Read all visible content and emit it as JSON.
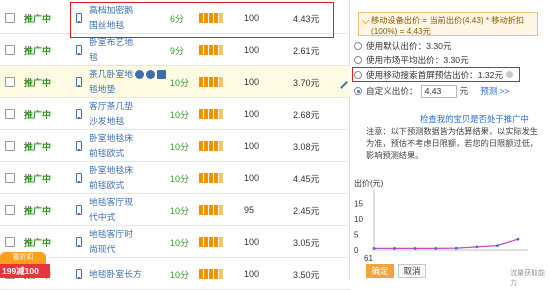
{
  "rows": [
    {
      "status": "推广中",
      "title1": "高档加密鹅",
      "title2": "国丝地毯",
      "score": "6分",
      "bars": 5,
      "pv": "100",
      "price": "4.43元",
      "highlight": false,
      "icons": false
    },
    {
      "status": "推广中",
      "title1": "卧室布艺地",
      "title2": "毯",
      "score": "9分",
      "bars": 5,
      "pv": "100",
      "price": "2.61元",
      "highlight": false,
      "icons": false
    },
    {
      "status": "推广中",
      "title1": "茶几卧室地",
      "title2": "毯地垫",
      "score": "10分",
      "bars": 5,
      "pv": "100",
      "price": "3.70元",
      "highlight": true,
      "icons": true
    },
    {
      "status": "推广中",
      "title1": "客厅茶几垫",
      "title2": "沙发地毯",
      "score": "10分",
      "bars": 5,
      "pv": "100",
      "price": "2.68元",
      "highlight": false,
      "icons": false
    },
    {
      "status": "推广中",
      "title1": "卧室地毯床",
      "title2": "前毯欧式",
      "score": "10分",
      "bars": 5,
      "pv": "100",
      "price": "3.08元",
      "highlight": false,
      "icons": false
    },
    {
      "status": "推广中",
      "title1": "卧室地毯床",
      "title2": "前毯欧式",
      "score": "10分",
      "bars": 5,
      "pv": "100",
      "price": "4.45元",
      "highlight": false,
      "icons": false
    },
    {
      "status": "推广中",
      "title1": "地毯客厅现",
      "title2": "代中式",
      "score": "10分",
      "bars": 5,
      "pv": "95",
      "price": "2.45元",
      "highlight": false,
      "icons": false
    },
    {
      "status": "推广中",
      "title1": "地毯客厅时",
      "title2": "尚现代",
      "score": "10分",
      "bars": 5,
      "pv": "100",
      "price": "3.05元",
      "highlight": false,
      "icons": false
    },
    {
      "status": "推广中",
      "title1": "地毯卧室长方",
      "title2": "",
      "score": "10分",
      "bars": 5,
      "pv": "100",
      "price": "3.50元",
      "highlight": false,
      "icons": false
    }
  ],
  "promo": {
    "top": "惠折扣",
    "bottom": "199减100"
  },
  "panel": {
    "notice": "移动设备出价 = 当前出价(4.43) * 移动折扣(100%) = 4.43元",
    "options": [
      {
        "label": "使用默认出价：3.30元",
        "selected": false
      },
      {
        "label": "使用市场平均出价：3.30元",
        "selected": false
      },
      {
        "label": "使用移动搜索首屏预估出价：1.32元",
        "selected": false
      }
    ],
    "custom_label": "自定义出价：",
    "custom_value": "4.43",
    "custom_unit": "元",
    "predict": "预测",
    "predict_arrow": ">>",
    "check_link": "检查我的宝贝是否处于推广中",
    "note": "注意：以下预测数据皆为估算结果，以实际发生为准，预估不考虑日限额，若您的日限额过低，影响预测结果。",
    "confirm": "确定",
    "cancel": "取消",
    "watermark": "流量获取能力"
  },
  "chart_data": {
    "type": "line",
    "ylabel": "出价(元)",
    "yticks": [
      "15",
      "10",
      "5",
      "0"
    ],
    "xticks": [
      "61"
    ],
    "ylim": [
      0,
      18
    ],
    "series": [
      {
        "values": [
          0.5,
          0.5,
          0.5,
          0.5,
          0.6,
          1.0,
          1.4,
          3.5
        ]
      }
    ]
  },
  "colors": {
    "status_green": "#3b8d2a",
    "link_blue": "#2a6fcf",
    "bar_orange": "#f29200",
    "box_red": "#e21b1b",
    "line_series": "#c44ec0"
  }
}
